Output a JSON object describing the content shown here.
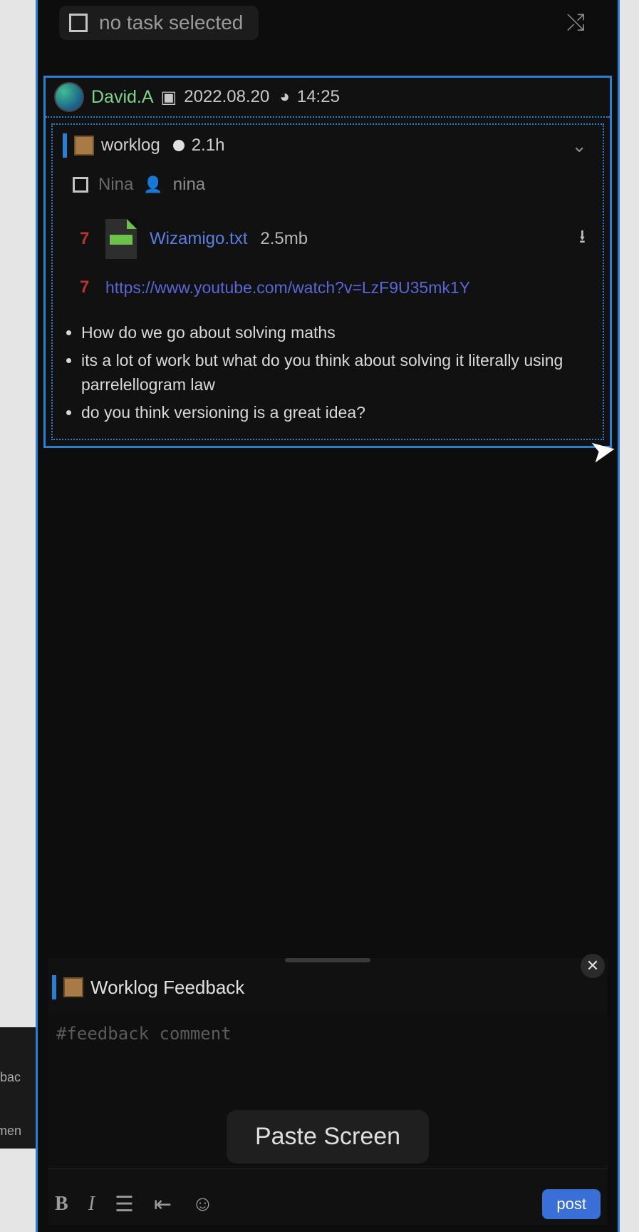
{
  "top": {
    "task_label": "no task selected"
  },
  "card": {
    "author": "David.A",
    "date": "2022.08.20",
    "time": "14:25",
    "worklog_label": "worklog",
    "worklog_duration": "2.1h",
    "assignee_label": "Nina",
    "assignee_handle": "nina",
    "attachment": {
      "index": "7",
      "filename": "Wizamigo.txt",
      "size": "2.5mb"
    },
    "link": {
      "index": "7",
      "url": "https://www.youtube.com/watch?v=LzF9U35mk1Y"
    },
    "bullets": [
      "How do we go about solving maths",
      "its a lot of work but what do you think about solving it literally using parrelellogram law",
      "do you think versioning is a great idea?"
    ]
  },
  "feedback": {
    "title": "Worklog Feedback",
    "placeholder": "#feedback comment",
    "paste_label": "Paste Screen",
    "post_label": "post",
    "toolbar": {
      "bold": "B",
      "italic": "I"
    }
  },
  "side": {
    "item1": "edbac",
    "item2": "mmen"
  }
}
